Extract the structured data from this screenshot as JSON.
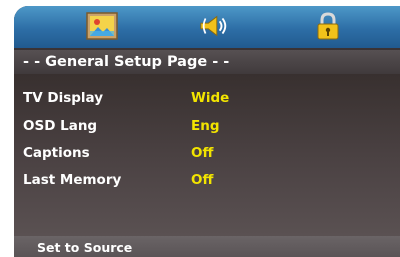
{
  "tabs": [
    {
      "icon": "picture-icon"
    },
    {
      "icon": "speaker-icon"
    },
    {
      "icon": "lock-icon"
    }
  ],
  "page_title": "- - General Setup Page - -",
  "settings": [
    {
      "label": "TV Display",
      "value": "Wide"
    },
    {
      "label": "OSD Lang",
      "value": "Eng"
    },
    {
      "label": "Captions",
      "value": "Off"
    },
    {
      "label": "Last Memory",
      "value": "Off"
    }
  ],
  "status_text": "Set to Source",
  "colors": {
    "tab_bar": "#2d6ea6",
    "value_text": "#f2e400",
    "background": "#3a3335"
  }
}
